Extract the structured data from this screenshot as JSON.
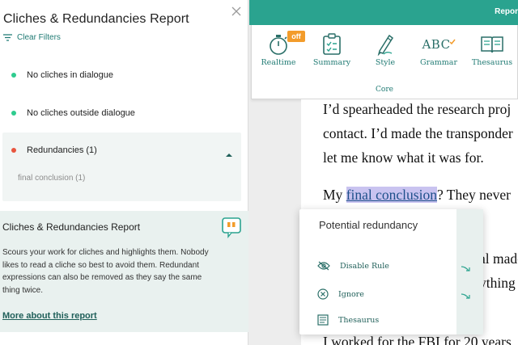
{
  "panel": {
    "title": "Cliches & Redundancies Report",
    "clear_filters": "Clear Filters",
    "items": [
      {
        "label": "No cliches in dialogue",
        "color": "#2ecc8f"
      },
      {
        "label": "No cliches outside dialogue",
        "color": "#2ecc8f"
      }
    ],
    "redundancies": {
      "label": "Redundancies (1)",
      "color": "#e8553e",
      "sub_item": "final conclusion (1)"
    },
    "info": {
      "title": "Cliches & Redundancies Report",
      "body": "Scours your work for cliches and highlights them. Nobody likes to read a cliche so best to avoid them. Redundant expressions can also be removed as they say the same thing twice.",
      "link": "More about this report"
    }
  },
  "topbar": {
    "title": "Repor"
  },
  "toolbar": {
    "tools": [
      {
        "label": "Realtime",
        "icon": "stopwatch-icon"
      },
      {
        "label": "Summary",
        "icon": "clipboard-icon"
      },
      {
        "label": "Style",
        "icon": "pencil-icon"
      },
      {
        "label": "Grammar",
        "icon": "abc-check-icon",
        "icon_text": "ABC"
      },
      {
        "label": "Thesaurus",
        "icon": "book-icon"
      }
    ],
    "badge": "off",
    "section": "Core"
  },
  "doc": {
    "line1": "I’d spearheaded the research proj",
    "line2": "contact. I’d made the transponder",
    "line3": "let me know what it was for.",
    "line4_pre": "My ",
    "line4_hl": "final conclusion",
    "line4_post": "? They never",
    "line5_frag": "al made",
    "line6_frag": "ything",
    "line7": "I worked for the FBI for 20 years"
  },
  "popup": {
    "title": "Potential redundancy",
    "items": [
      {
        "label": "Disable Rule",
        "icon": "eye-off-icon"
      },
      {
        "label": "Ignore",
        "icon": "x-circle-icon"
      },
      {
        "label": "Thesaurus",
        "icon": "book-icon"
      }
    ]
  }
}
